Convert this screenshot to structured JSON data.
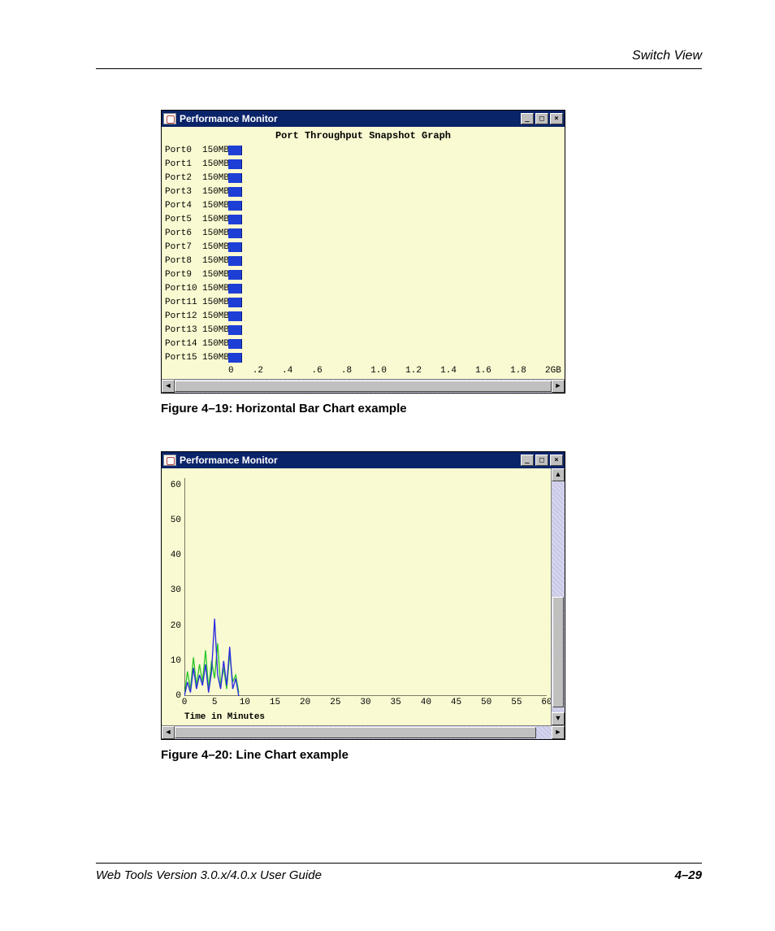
{
  "header": {
    "section_title": "Switch View"
  },
  "figure1": {
    "window_title": "Performance Monitor",
    "chart_title": "Port Throughput Snapshot Graph",
    "caption": "Figure 4–19:  Horizontal Bar Chart example"
  },
  "figure2": {
    "window_title": "Performance Monitor",
    "xlabel": "Time in Minutes",
    "caption": "Figure 4–20:  Line Chart example"
  },
  "footer": {
    "doc_title": "Web Tools Version 3.0.x/4.0.x User Guide",
    "page_number": "4–29"
  },
  "chart_data": [
    {
      "type": "bar",
      "title": "Port Throughput Snapshot Graph",
      "orientation": "horizontal",
      "categories": [
        "Port0",
        "Port1",
        "Port2",
        "Port3",
        "Port4",
        "Port5",
        "Port6",
        "Port7",
        "Port8",
        "Port9",
        "Port10",
        "Port11",
        "Port12",
        "Port13",
        "Port14",
        "Port15"
      ],
      "value_labels": [
        "150MB",
        "150MB",
        "150MB",
        "150MB",
        "150MB",
        "150MB",
        "150MB",
        "150MB",
        "150MB",
        "150MB",
        "150MB",
        "150MB",
        "150MB",
        "150MB",
        "150MB",
        "150MB"
      ],
      "values": [
        0.075,
        0.075,
        0.075,
        0.075,
        0.075,
        0.075,
        0.075,
        0.075,
        0.075,
        0.075,
        0.075,
        0.075,
        0.075,
        0.075,
        0.075,
        0.075
      ],
      "x_ticks": [
        "0",
        ".2",
        ".4",
        ".6",
        ".8",
        "1.0",
        "1.2",
        "1.4",
        "1.6",
        "1.8",
        "2GB"
      ],
      "xlim": [
        0,
        2.0
      ],
      "xlabel": "",
      "ylabel": ""
    },
    {
      "type": "line",
      "title": "",
      "xlabel": "Time in Minutes",
      "ylabel": "",
      "x_ticks": [
        0,
        5,
        10,
        15,
        20,
        25,
        30,
        35,
        40,
        45,
        50,
        55,
        60
      ],
      "y_ticks": [
        0,
        10,
        20,
        30,
        40,
        50,
        60
      ],
      "xlim": [
        0,
        60
      ],
      "ylim": [
        0,
        62
      ],
      "series": [
        {
          "name": "series-green",
          "color": "#2cc62c",
          "x": [
            0,
            0.5,
            1,
            1.5,
            2,
            2.5,
            3,
            3.5,
            4,
            4.5,
            5,
            5.5,
            6,
            6.5,
            7,
            7.5,
            8,
            8.5,
            9
          ],
          "values": [
            0,
            7,
            2,
            11,
            3,
            9,
            4,
            13,
            2,
            10,
            5,
            15,
            3,
            8,
            2,
            12,
            4,
            6,
            1
          ]
        },
        {
          "name": "series-blue",
          "color": "#2a2ae0",
          "x": [
            0,
            0.5,
            1,
            1.5,
            2,
            2.5,
            3,
            3.5,
            4,
            4.5,
            5,
            5.5,
            6,
            6.5,
            7,
            7.5,
            8,
            8.5,
            9
          ],
          "values": [
            0,
            4,
            1,
            8,
            2,
            6,
            3,
            9,
            1,
            7,
            22,
            6,
            2,
            10,
            3,
            14,
            2,
            5,
            0
          ]
        }
      ]
    }
  ]
}
